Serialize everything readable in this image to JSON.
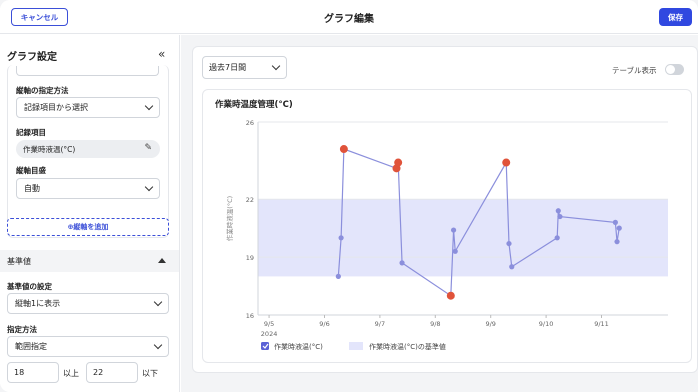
{
  "header": {
    "cancel_label": "キャンセル",
    "title": "グラフ編集",
    "save_label": "保存"
  },
  "sidebar": {
    "title": "グラフ設定",
    "collapse_icon": "«",
    "axis_method_label": "縦軸の指定方法",
    "axis_method_value": "記録項目から選択",
    "record_item_label": "記録項目",
    "record_item_value": "作業時液温(°C)",
    "axis_scale_label": "縦軸目盛",
    "axis_scale_value": "自動",
    "add_axis_label": "⊕縦軸を追加",
    "reference_section": "基準値",
    "ref_setting_label": "基準値の設定",
    "ref_setting_value": "縦軸1に表示",
    "spec_method_label": "指定方法",
    "spec_method_value": "範囲指定",
    "range_min": "18",
    "range_min_unit": "以上",
    "range_max": "22",
    "range_max_unit": "以下"
  },
  "main": {
    "period_value": "過去7日間",
    "table_toggle_label": "テーブル表示"
  },
  "chart_data": {
    "type": "line",
    "title": "作業時温度管理(°C)",
    "ylabel": "作業時液温(°C)",
    "ylim": [
      16,
      26
    ],
    "yticks": [
      26,
      22,
      19,
      16
    ],
    "xticks": [
      "9/5",
      "9/6",
      "9/7",
      "9/8",
      "9/9",
      "9/10",
      "9/11"
    ],
    "x_year_label": "2024",
    "reference_band": {
      "min": 18,
      "max": 22,
      "name": "作業時液温(°C)の基準値",
      "color": "#e3e5fb"
    },
    "series": [
      {
        "name": "作業時液温(°C)",
        "color": "#8b8fdc",
        "points": [
          {
            "x": 6.25,
            "y": 18.0,
            "alert": false
          },
          {
            "x": 6.3,
            "y": 20.0,
            "alert": false
          },
          {
            "x": 6.35,
            "y": 24.6,
            "alert": true
          },
          {
            "x": 7.3,
            "y": 23.6,
            "alert": true
          },
          {
            "x": 7.33,
            "y": 23.9,
            "alert": true
          },
          {
            "x": 7.4,
            "y": 18.7,
            "alert": false
          },
          {
            "x": 8.28,
            "y": 17.0,
            "alert": true
          },
          {
            "x": 8.33,
            "y": 20.4,
            "alert": false
          },
          {
            "x": 8.36,
            "y": 19.3,
            "alert": false
          },
          {
            "x": 9.28,
            "y": 23.9,
            "alert": true
          },
          {
            "x": 9.33,
            "y": 19.7,
            "alert": false
          },
          {
            "x": 9.38,
            "y": 18.5,
            "alert": false
          },
          {
            "x": 10.2,
            "y": 20.0,
            "alert": false
          },
          {
            "x": 10.22,
            "y": 21.4,
            "alert": false
          },
          {
            "x": 10.25,
            "y": 21.1,
            "alert": false
          },
          {
            "x": 11.25,
            "y": 20.8,
            "alert": false
          },
          {
            "x": 11.28,
            "y": 19.8,
            "alert": false
          },
          {
            "x": 11.32,
            "y": 20.5,
            "alert": false
          }
        ]
      }
    ],
    "alert_color": "#e0533a"
  }
}
